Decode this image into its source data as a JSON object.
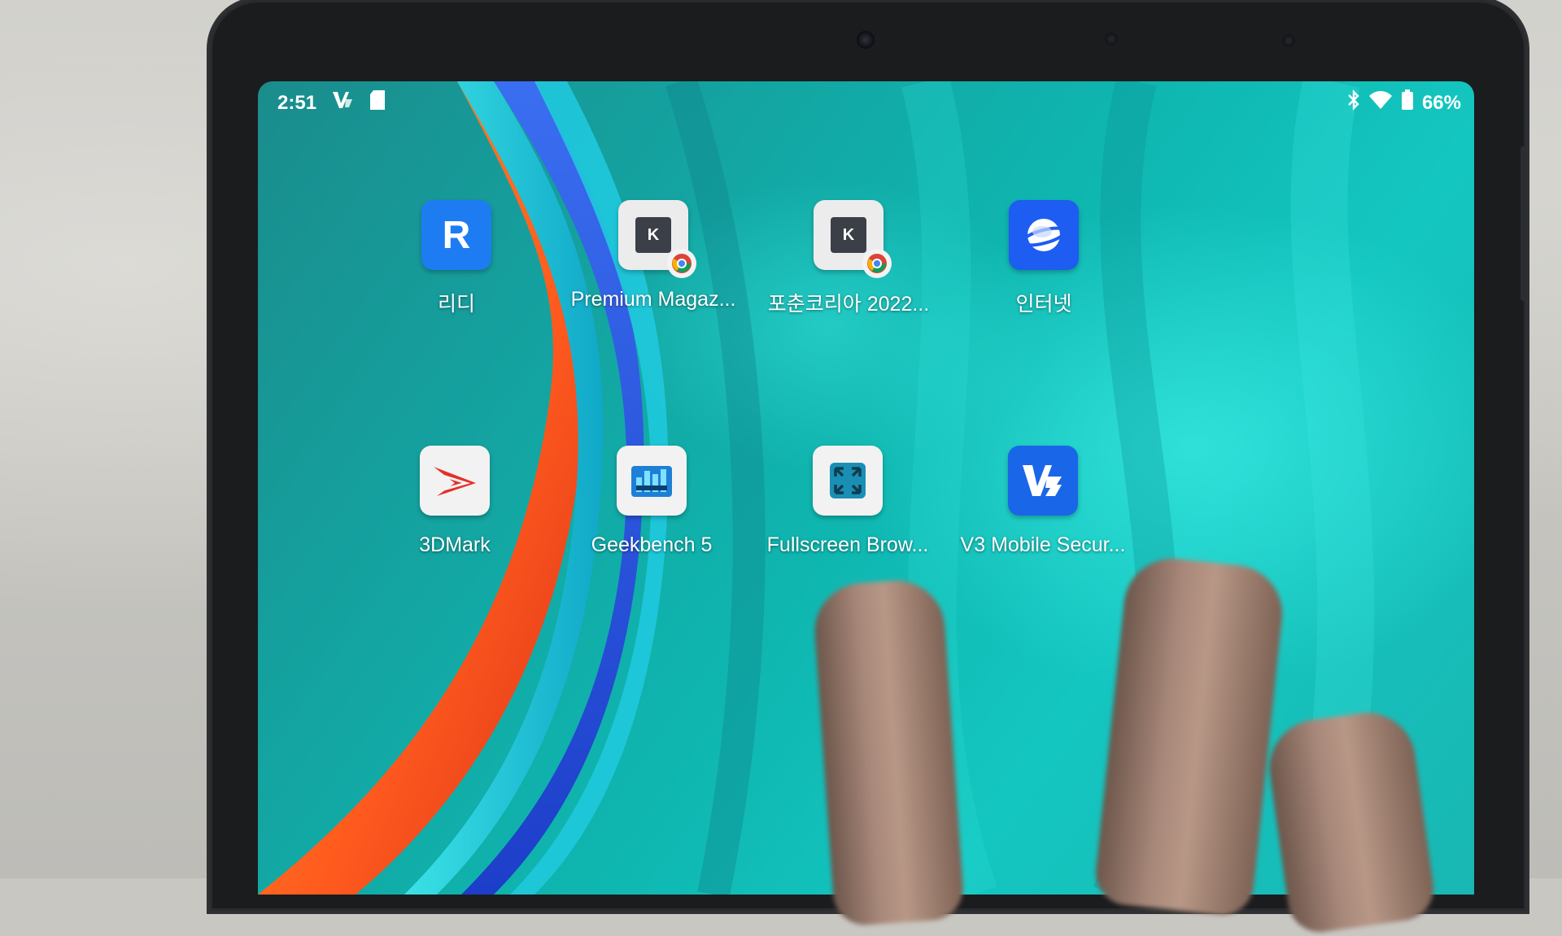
{
  "status_bar": {
    "time": "2:51",
    "left_icons": [
      "v3-security-icon",
      "sd-card-icon"
    ],
    "right_icons": [
      "bluetooth-icon",
      "wifi-icon",
      "battery-icon"
    ],
    "battery": "66%"
  },
  "home_screen": {
    "apps": [
      {
        "label": "리디",
        "icon": "ridi-icon",
        "glyph": "R",
        "color": "#1e7cf2"
      },
      {
        "label": "Premium Magaz...",
        "icon": "kindle-web-shortcut-icon",
        "glyph": "K",
        "color": "#ececec"
      },
      {
        "label": "포춘코리아 2022...",
        "icon": "kindle-web-shortcut-icon",
        "glyph": "K",
        "color": "#ececec"
      },
      {
        "label": "인터넷",
        "icon": "samsung-internet-icon",
        "glyph": "",
        "color": "#1d5df2"
      },
      {
        "label": "3DMark",
        "icon": "3dmark-icon",
        "glyph": "",
        "color": "#f2f2f2"
      },
      {
        "label": "Geekbench 5",
        "icon": "geekbench-icon",
        "glyph": "",
        "color": "#f2f2f2"
      },
      {
        "label": "Fullscreen Brow...",
        "icon": "fullscreen-browser-icon",
        "glyph": "",
        "color": "#f2f2f2"
      },
      {
        "label": "V3 Mobile Secur...",
        "icon": "v3-mobile-security-icon",
        "glyph": "V3",
        "color": "#1a66e8"
      }
    ]
  }
}
